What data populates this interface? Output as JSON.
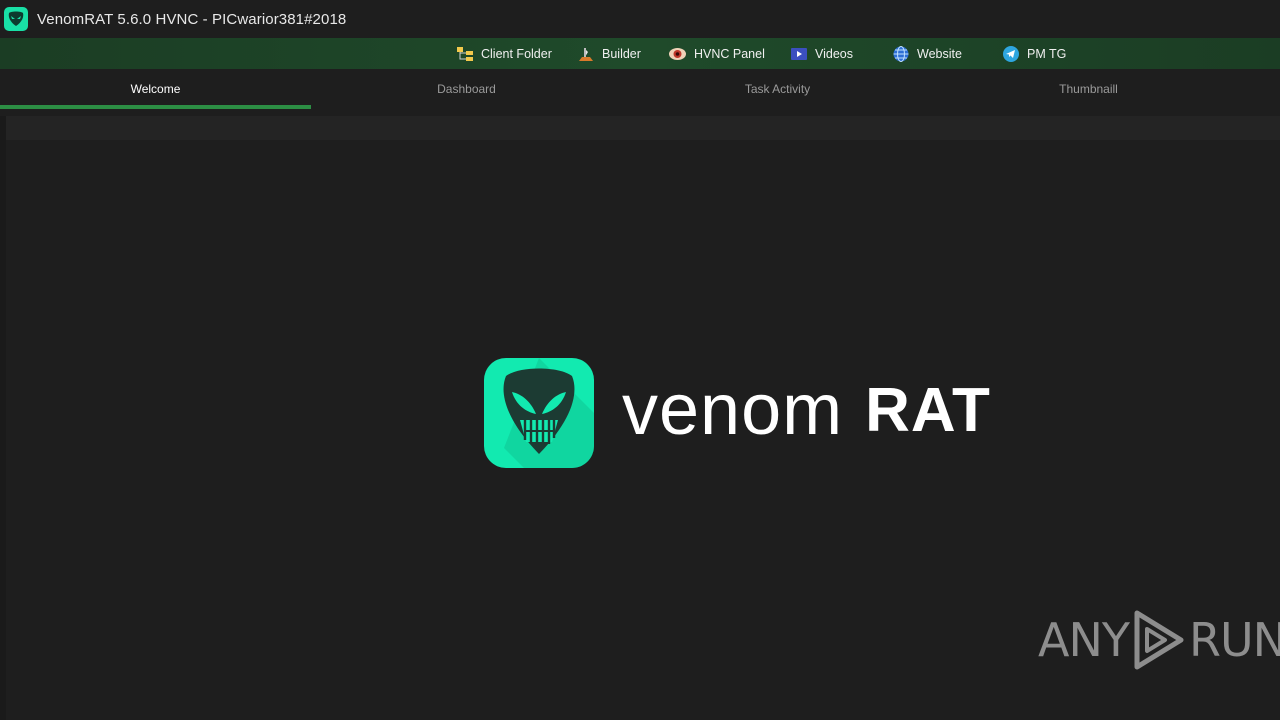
{
  "window": {
    "title": "VenomRAT 5.6.0 HVNC - PICwarior381#2018",
    "icon": "venom-mask-icon",
    "accent": "#19e0a6"
  },
  "toolbar": {
    "items": [
      {
        "label": "Client Folder",
        "icon": "folder-tree-icon"
      },
      {
        "label": "Builder",
        "icon": "builder-icon"
      },
      {
        "label": "HVNC Panel",
        "icon": "eye-icon"
      },
      {
        "label": "Videos",
        "icon": "video-icon"
      },
      {
        "label": "Website",
        "icon": "globe-icon"
      },
      {
        "label": "PM TG",
        "icon": "telegram-icon"
      }
    ]
  },
  "tabs": [
    {
      "label": "Welcome",
      "active": true
    },
    {
      "label": "Dashboard",
      "active": false
    },
    {
      "label": "Task Activity",
      "active": false
    },
    {
      "label": "Thumbnaill",
      "active": false
    }
  ],
  "logo": {
    "text_light": "venom",
    "text_bold": "RAT",
    "icon": "venom-mask-icon",
    "color": "#12eab0"
  },
  "watermark": {
    "left": "ANY",
    "right": "RUN"
  }
}
